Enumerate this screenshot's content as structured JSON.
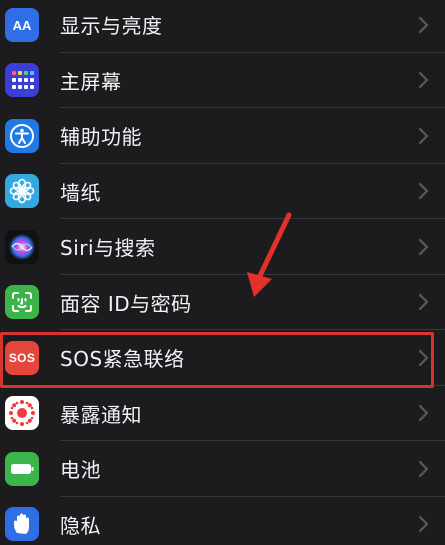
{
  "settings": {
    "items": [
      {
        "label": "显示与亮度",
        "icon": "text-size-icon",
        "color": "#2f6ee5"
      },
      {
        "label": "主屏幕",
        "icon": "home-screen-grid-icon",
        "color": "#3b3fd8"
      },
      {
        "label": "辅助功能",
        "icon": "accessibility-icon",
        "color": "#1f7ae6"
      },
      {
        "label": "墙纸",
        "icon": "wallpaper-flower-icon",
        "color": "#34a9e0"
      },
      {
        "label": "Siri与搜索",
        "icon": "siri-icon",
        "color": "#111111"
      },
      {
        "label": "面容 ID与密码",
        "icon": "face-id-icon",
        "color": "#3bb54a"
      },
      {
        "label": "SOS紧急联络",
        "icon": "sos-icon",
        "color": "#e5463c",
        "icon_text": "SOS"
      },
      {
        "label": "暴露通知",
        "icon": "exposure-notification-icon",
        "color": "#ffffff"
      },
      {
        "label": "电池",
        "icon": "battery-icon",
        "color": "#3bb54a"
      },
      {
        "label": "隐私",
        "icon": "privacy-hand-icon",
        "color": "#2f6ee5"
      }
    ]
  },
  "colors": {
    "background": "#1c1c1e",
    "highlight": "#d9342b"
  }
}
